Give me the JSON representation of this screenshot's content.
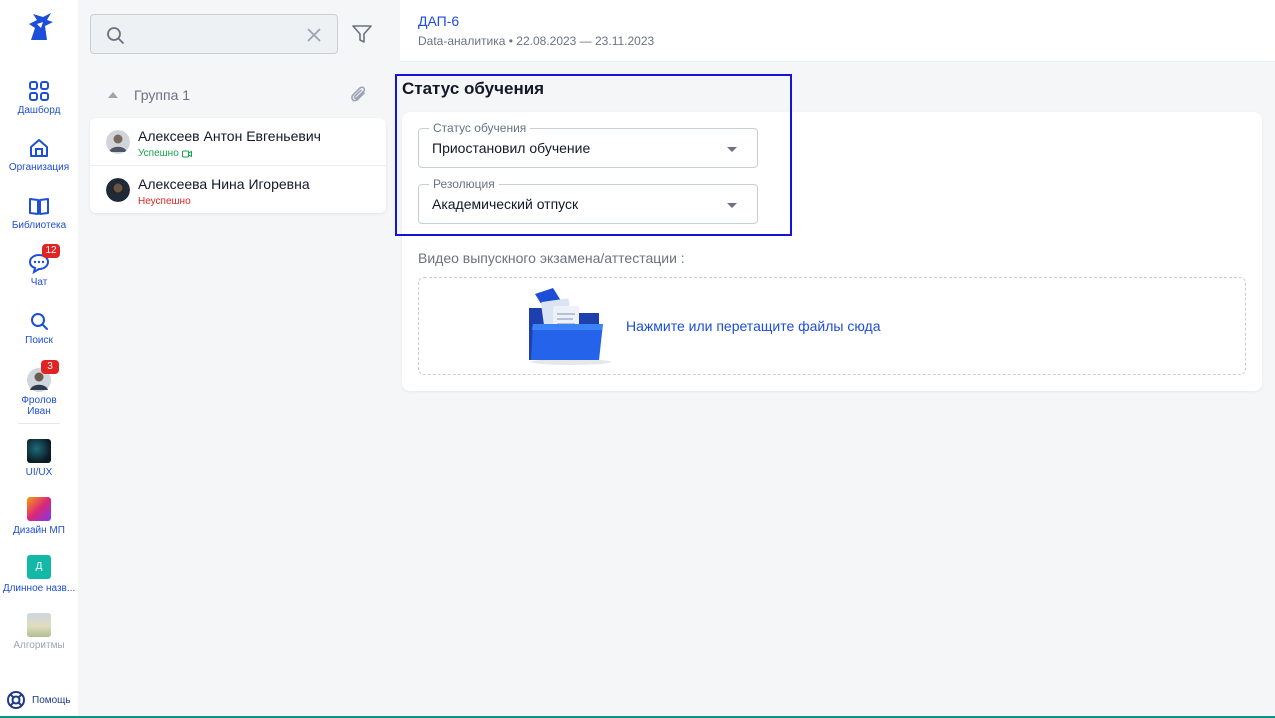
{
  "rail": {
    "logo": "knight-helmet-logo",
    "items": [
      {
        "label": "Дашборд",
        "icon": "grid-icon"
      },
      {
        "label": "Организация",
        "icon": "home-icon"
      },
      {
        "label": "Библиотека",
        "icon": "book-icon"
      },
      {
        "label": "Чат",
        "icon": "chat-icon",
        "badge": "12"
      },
      {
        "label": "Поиск",
        "icon": "search-icon"
      },
      {
        "label": "Фролов Иван",
        "icon": "user-avatar",
        "badge": "3"
      },
      {
        "label": "UI/UX",
        "icon": "course-thumbnail"
      },
      {
        "label": "Дизайн МП",
        "icon": "course-thumbnail"
      },
      {
        "label": "Длинное назв...",
        "icon": "course-letter",
        "letter": "Д"
      },
      {
        "label": "Алгоритмы",
        "icon": "course-thumbnail"
      }
    ],
    "help_label": "Помощь"
  },
  "list": {
    "search_placeholder": "",
    "group_name": "Группа 1",
    "people": [
      {
        "name": "Алексеев Антон Евгеньевич",
        "status": "Успешно",
        "status_type": "success"
      },
      {
        "name": "Алексеева Нина Игоревна",
        "status": "Неуспешно",
        "status_type": "fail"
      }
    ]
  },
  "header": {
    "course": "ДАП-6",
    "meta": "Data-аналитика • 22.08.2023 — 23.11.2023"
  },
  "main": {
    "section_title": "Статус обучения",
    "status_select": {
      "legend": "Статус обучения",
      "value": "Приостановил обучение"
    },
    "resolution_select": {
      "legend": "Резолюция",
      "value": "Академический отпуск"
    },
    "video_label": "Видео выпускного экзамена/аттестации :",
    "dropzone_text": "Нажмите или перетащите файлы сюда"
  },
  "colors": {
    "accent": "#1d4ed8",
    "highlight": "#1414d8",
    "success": "#16a34a",
    "fail": "#e02424",
    "badge": "#e02424"
  }
}
